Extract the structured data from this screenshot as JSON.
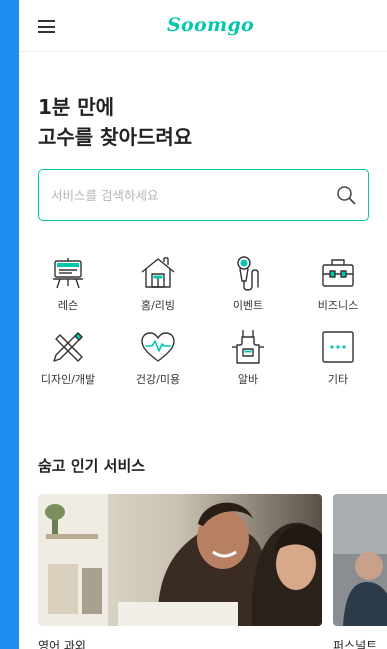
{
  "header": {
    "menu_icon": "hamburger-icon",
    "logo": "Soomgo"
  },
  "hero": {
    "line1": "1분 만에",
    "line2": "고수를 찾아드려요"
  },
  "search": {
    "placeholder": "서비스를 검색하세요",
    "icon": "search-icon"
  },
  "categories": [
    {
      "label": "레슨",
      "icon": "easel-icon"
    },
    {
      "label": "홈/리빙",
      "icon": "house-icon"
    },
    {
      "label": "이벤트",
      "icon": "microphone-icon"
    },
    {
      "label": "비즈니스",
      "icon": "briefcase-icon"
    },
    {
      "label": "디자인/개발",
      "icon": "pencil-ruler-icon"
    },
    {
      "label": "건강/미용",
      "icon": "heart-pulse-icon"
    },
    {
      "label": "알바",
      "icon": "apron-icon"
    },
    {
      "label": "기타",
      "icon": "more-icon"
    }
  ],
  "popular": {
    "title": "숨고 인기 서비스",
    "cards": [
      {
        "title": "영어 과외"
      },
      {
        "title": "퍼스널트"
      }
    ]
  },
  "colors": {
    "accent": "#00c7ae",
    "outer": "#1e8cf0",
    "text": "#222222"
  }
}
